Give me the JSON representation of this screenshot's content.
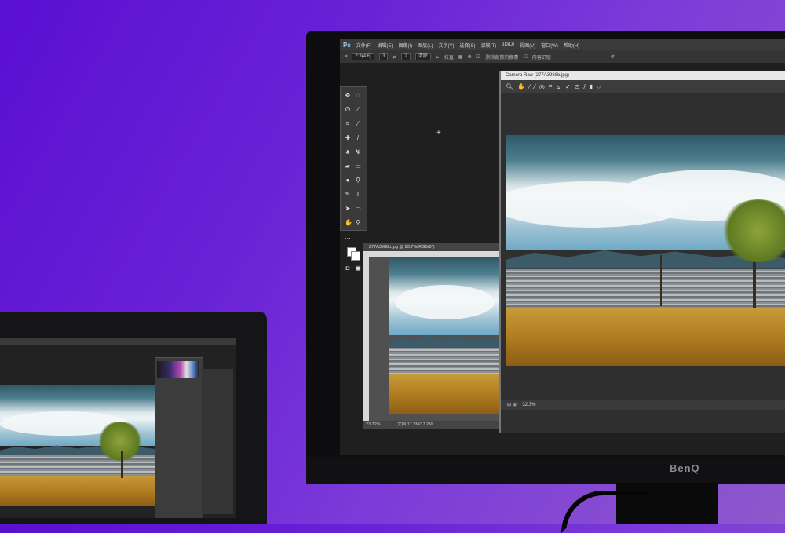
{
  "photoshop": {
    "logo": "Ps",
    "menu": [
      "文件(F)",
      "编辑(E)",
      "图像(I)",
      "图层(L)",
      "文字(Y)",
      "选择(S)",
      "滤镜(T)",
      "3D(D)",
      "视图(V)",
      "窗口(W)",
      "帮助(H)"
    ],
    "options": {
      "ratio": "2:3(4:6)",
      "width_value": "3",
      "height_value": "2",
      "clear_label": "清除",
      "straighten_label": "拉直",
      "delete_cropped_label": "删除裁剪的像素",
      "content_aware_label": "内容识别"
    },
    "document": {
      "title": "277A3988b.jpg @ 23.7%(RGB/8*)",
      "zoom": "23.72%",
      "doc_size": "文档:17.2M/17.2M"
    },
    "camera_raw": {
      "title": "Camera Raw (277A3988b.jpg)",
      "zoom": "32.3%"
    }
  },
  "monitor": {
    "brand": "BenQ"
  },
  "icons": [
    "zoom-icon",
    "hand-icon",
    "white-balance-icon",
    "color-sampler-icon",
    "targeted-adjust-icon",
    "crop-icon",
    "straighten-icon",
    "spot-removal-icon",
    "red-eye-icon",
    "adjustment-brush-icon",
    "graduated-filter-icon",
    "radial-filter-icon"
  ]
}
